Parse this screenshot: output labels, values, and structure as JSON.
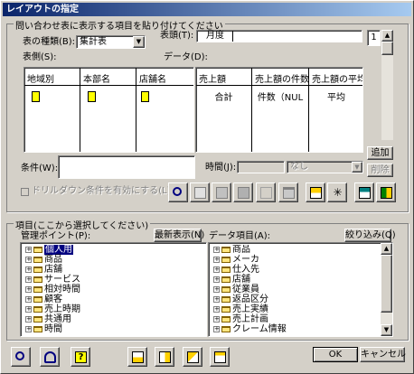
{
  "window": {
    "title": "レイアウトの指定"
  },
  "top_group": {
    "label": "問い合わせ表に表示する項目を貼り付けてください"
  },
  "table_type": {
    "label": "表の種類(B):",
    "value": "集計表"
  },
  "sheet": {
    "label": "表側(S):"
  },
  "header": {
    "label": "表頭(T):",
    "cell_value": "月度",
    "page_number": "1"
  },
  "data_label": "データ(D):",
  "left_columns": [
    {
      "label": "地域別"
    },
    {
      "label": "本部名"
    },
    {
      "label": "店舗名"
    }
  ],
  "right_columns": [
    {
      "label": "売上額",
      "value": "合計"
    },
    {
      "label": "売上額の件数",
      "value": "件数（NUL"
    },
    {
      "label": "売上額の平均",
      "value": "平均"
    }
  ],
  "condition": {
    "label": "条件(W):",
    "value": ""
  },
  "time": {
    "label": "時間(J):",
    "value": "",
    "select_value": "なし"
  },
  "buttons": {
    "add": "追加",
    "delete": "削除",
    "show_latest": "最新表示(N)",
    "filter": "絞り込み(Q)",
    "ok": "OK",
    "cancel": "キャンセル"
  },
  "drilldown_checkbox": {
    "label": "ドリルダウン条件を有効にする(L)",
    "checked": false
  },
  "bottom_group": {
    "label": "項目(ここから選択してください)"
  },
  "mgmt_points": {
    "label": "管理ポイント(P):",
    "items": [
      {
        "label": "個人用",
        "selected": true
      },
      {
        "label": "商品"
      },
      {
        "label": "店舗"
      },
      {
        "label": "サービス"
      },
      {
        "label": "相対時間"
      },
      {
        "label": "顧客"
      },
      {
        "label": "売上時期"
      },
      {
        "label": "共通用"
      },
      {
        "label": "時間"
      }
    ]
  },
  "data_items": {
    "label": "データ項目(A):",
    "items": [
      {
        "label": "商品"
      },
      {
        "label": "メーカ"
      },
      {
        "label": "仕入先"
      },
      {
        "label": "店舗"
      },
      {
        "label": "従業員"
      },
      {
        "label": "返品区分"
      },
      {
        "label": "売上実績"
      },
      {
        "label": "売上計画"
      },
      {
        "label": "クレーム情報"
      }
    ]
  },
  "colors": {
    "title_start": "#0a246a",
    "title_end": "#a6caf0",
    "selection": "#000080",
    "face": "#d4d0c8"
  }
}
